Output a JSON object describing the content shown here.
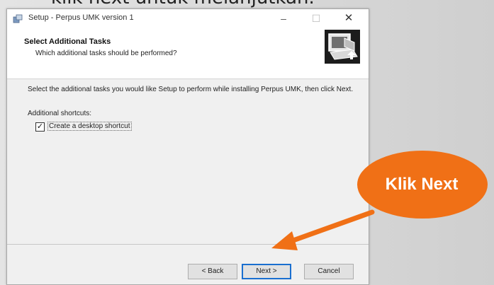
{
  "slide": {
    "caption_fragment": "klik next untuk melanjutkan."
  },
  "window": {
    "title": "Setup - Perpus UMK version 1",
    "min_glyph": "–",
    "max_glyph": "☐",
    "close_glyph": "✕"
  },
  "header": {
    "title": "Select Additional Tasks",
    "subtitle": "Which additional tasks should be performed?"
  },
  "content": {
    "description": "Select the additional tasks you would like Setup to perform while installing Perpus UMK, then click Next.",
    "shortcuts_label": "Additional shortcuts:",
    "checkbox_label": "Create a desktop shortcut",
    "checkbox_checked": true,
    "check_glyph": "✓"
  },
  "buttons": {
    "back": "< Back",
    "next": "Next >",
    "cancel": "Cancel"
  },
  "callout": {
    "text": "Klik Next",
    "color": "#f07016"
  }
}
